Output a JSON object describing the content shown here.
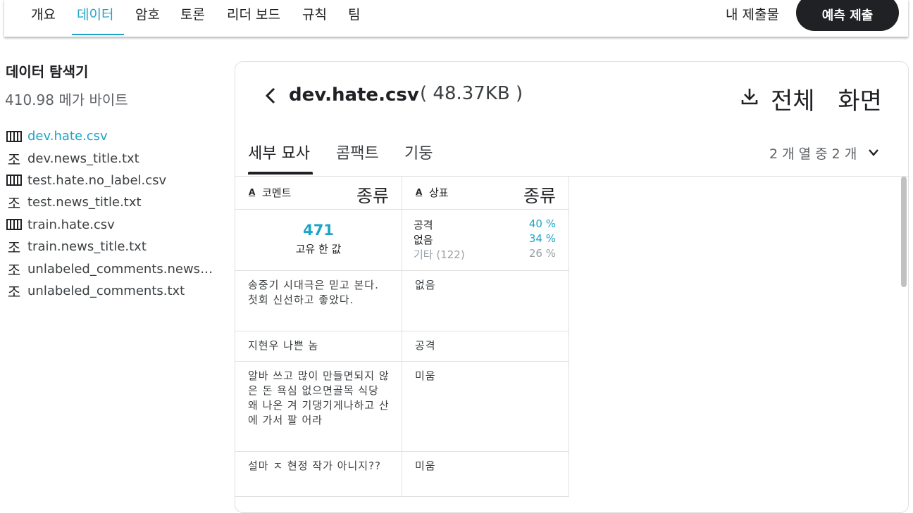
{
  "nav": {
    "tabs": [
      "개요",
      "데이터",
      "암호",
      "토론",
      "리더 보드",
      "규칙",
      "팀"
    ],
    "active_tab": "데이터",
    "my_submissions": "내 제출물",
    "submit_button": "예측 제출"
  },
  "sidebar": {
    "title": "데이터 탐색기",
    "size": "410.98 메가 바이트",
    "files": [
      {
        "name": "dev.hate.csv",
        "icon": "table-icon",
        "active": true
      },
      {
        "name": "dev.news_title.txt",
        "icon": "text-file-icon"
      },
      {
        "name": "test.hate.no_label.csv",
        "icon": "table-icon"
      },
      {
        "name": "test.news_title.txt",
        "icon": "text-file-icon"
      },
      {
        "name": "train.hate.csv",
        "icon": "table-icon"
      },
      {
        "name": "train.news_title.txt",
        "icon": "text-file-icon"
      },
      {
        "name": "unlabeled_comments.news_...",
        "icon": "text-file-icon"
      },
      {
        "name": "unlabeled_comments.txt",
        "icon": "text-file-icon"
      }
    ],
    "text_icon_glyph": "조"
  },
  "panel": {
    "file_name": "dev.hate.csv",
    "file_size": "( 48.37KB )",
    "fullscreen_label": "전체 화면",
    "tabs": [
      "세부 묘사",
      "콤팩트",
      "기둥"
    ],
    "active_tab": "세부 묘사",
    "column_count": "2 개 열 중 2 개"
  },
  "table": {
    "columns": [
      {
        "name": "코멘트",
        "type": "종류",
        "type_icon": "A"
      },
      {
        "name": "상표",
        "type": "종류",
        "type_icon": "A"
      }
    ],
    "comment_summary": {
      "unique_count": "471",
      "unique_label": "고유 한 값"
    },
    "label_summary": [
      {
        "label": "공격",
        "pct": "40 %"
      },
      {
        "label": "없음",
        "pct": "34 %"
      },
      {
        "label": "기타 (122)",
        "pct": "26 %"
      }
    ],
    "rows": [
      {
        "comment": "송중기 시대극은 믿고 본다. 첫회 신선하고 좋았다.",
        "label": "없음"
      },
      {
        "comment": "지현우 나쁜 놈",
        "label": "공격"
      },
      {
        "comment": "알바 쓰고 많이 만들면되지 않은 돈 욕심 없으면골목 식당 왜 나온 겨 기댕기게나하고 산에 가서 팔 어라",
        "label": "미움"
      },
      {
        "comment": "설마 ㅈ 현정 작가 아니지??",
        "label": "미움"
      }
    ]
  },
  "colors": {
    "accent": "#20a4c6",
    "dark": "#202124",
    "muted": "#9aa0a6"
  }
}
